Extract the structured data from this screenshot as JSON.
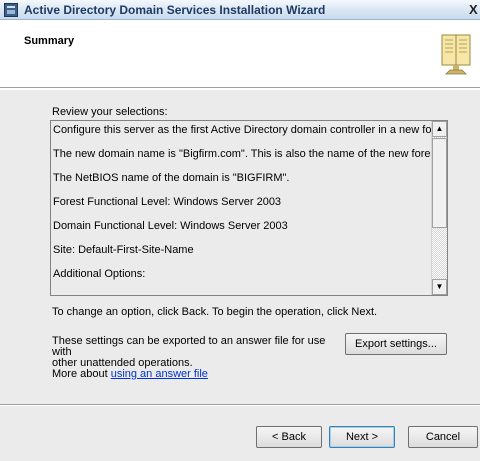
{
  "window": {
    "title": "Active Directory Domain Services Installation Wizard",
    "close_glyph": "X"
  },
  "header": {
    "page_title": "Summary",
    "icon": "book-icon"
  },
  "main": {
    "review_label": "Review your selections:",
    "summary_lines": [
      "Configure this server as the first Active Directory domain controller in a new forest.",
      "The new domain name is \"Bigfirm.com\". This is also the name of the new forest.",
      "The NetBIOS name of the domain is \"BIGFIRM\".",
      "Forest Functional Level: Windows Server 2003",
      "Domain Functional Level: Windows Server 2003",
      "Site: Default-First-Site-Name",
      "Additional Options:"
    ],
    "scroll_up_glyph": "▲",
    "scroll_down_glyph": "▼",
    "change_text": "To change an option, click Back. To begin the operation, click Next.",
    "export_text_1": "These settings can be exported to an answer file for use with",
    "export_text_2": "other unattended operations.",
    "export_text_3": "More about ",
    "export_link": "using an answer file",
    "export_button": "Export settings..."
  },
  "footer": {
    "back_button": "< Back",
    "next_button": "Next >",
    "cancel_button": "Cancel"
  }
}
